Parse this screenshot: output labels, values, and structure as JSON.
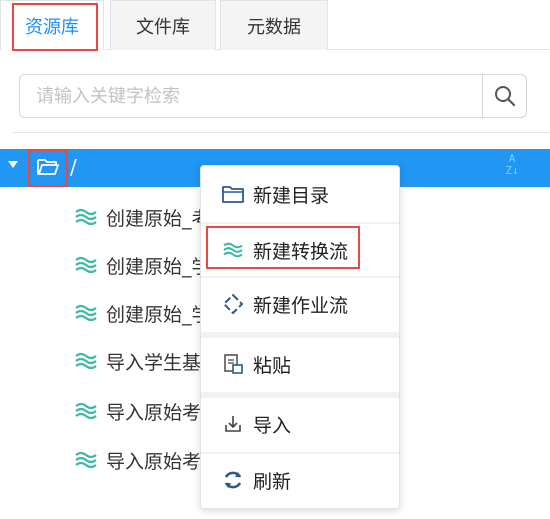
{
  "tabs": [
    {
      "label": "资源库",
      "active": true
    },
    {
      "label": "文件库",
      "active": false
    },
    {
      "label": "元数据",
      "active": false
    }
  ],
  "search": {
    "placeholder": "请输入关键字检索",
    "value": "",
    "icon": "search-icon"
  },
  "tree": {
    "root": {
      "label": "/",
      "expanded": true,
      "icon": "folder-open-icon",
      "sort_icon": "sort-az-icon"
    },
    "items": [
      {
        "label": "创建原始_考",
        "icon": "transformation-icon"
      },
      {
        "label": "创建原始_学",
        "icon": "transformation-icon"
      },
      {
        "label": "创建原始_学",
        "icon": "transformation-icon"
      },
      {
        "label": "导入学生基",
        "icon": "transformation-icon"
      },
      {
        "label": "导入原始考",
        "icon": "transformation-icon"
      },
      {
        "label": "导入原始考",
        "icon": "transformation-icon"
      }
    ]
  },
  "context_menu": {
    "items": [
      {
        "label": "新建目录",
        "icon": "folder-icon"
      },
      {
        "label": "新建转换流",
        "icon": "transformation-icon",
        "highlighted": true
      },
      {
        "label": "新建作业流",
        "icon": "job-icon"
      },
      {
        "label": "粘贴",
        "icon": "paste-icon"
      },
      {
        "label": "导入",
        "icon": "import-icon"
      },
      {
        "label": "刷新",
        "icon": "refresh-icon"
      }
    ]
  },
  "colors": {
    "accent": "#1890ff",
    "selection": "#2196f3",
    "highlight_border": "#e8483f",
    "transform_icon": "#3cb8a5"
  }
}
